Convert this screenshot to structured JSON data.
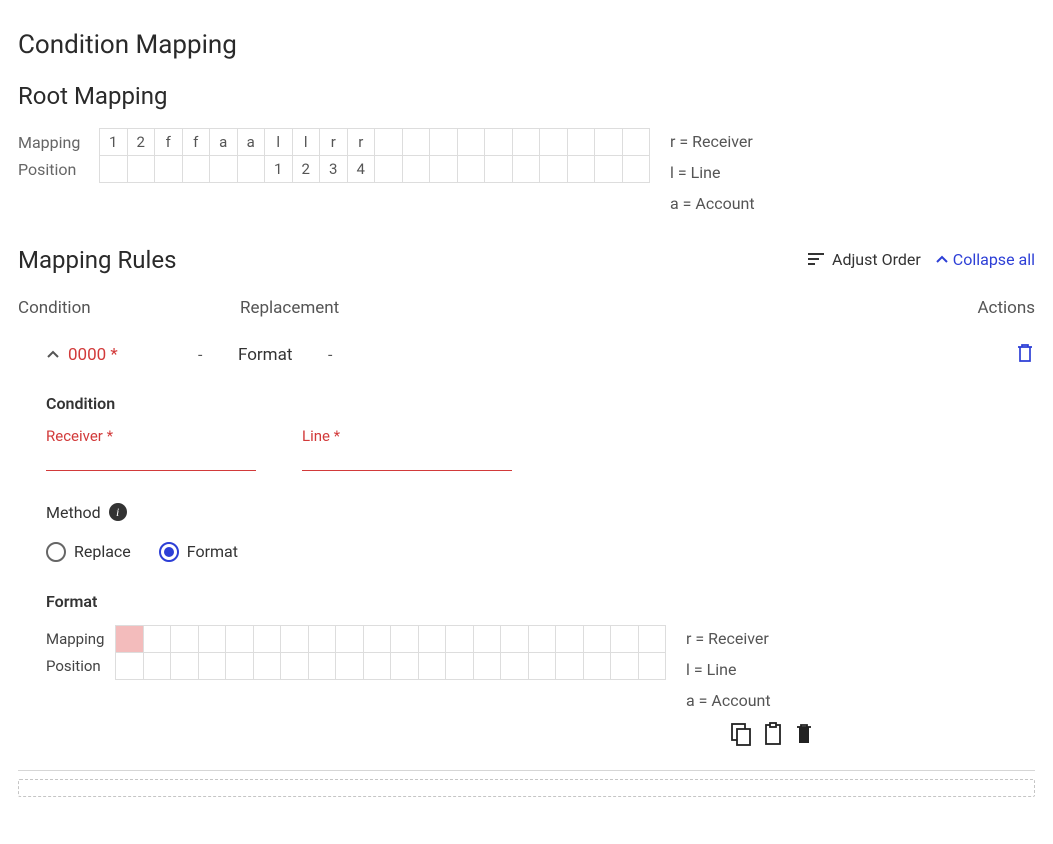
{
  "titles": {
    "condition_mapping": "Condition Mapping",
    "root_mapping": "Root Mapping",
    "mapping_rules": "Mapping Rules"
  },
  "root_mapping": {
    "row_labels": {
      "mapping": "Mapping",
      "position": "Position"
    },
    "cell_count": 20,
    "mapping_cells": [
      "1",
      "2",
      "f",
      "f",
      "a",
      "a",
      "l",
      "l",
      "r",
      "r",
      "",
      "",
      "",
      "",
      "",
      "",
      "",
      "",
      "",
      ""
    ],
    "position_cells": [
      "",
      "",
      "",
      "",
      "",
      "",
      "1",
      "2",
      "3",
      "4",
      "",
      "",
      "",
      "",
      "",
      "",
      "",
      "",
      "",
      ""
    ]
  },
  "legend": [
    {
      "k": "r",
      "v": "Receiver"
    },
    {
      "k": "l",
      "v": "Line"
    },
    {
      "k": "a",
      "v": "Account"
    }
  ],
  "mapping_rules": {
    "actions": {
      "adjust_order": "Adjust Order",
      "collapse_all": "Collapse all"
    },
    "headers": {
      "condition": "Condition",
      "replacement": "Replacement",
      "actions": "Actions"
    }
  },
  "rule": {
    "condition_display": "0000 *",
    "sep": "-",
    "replacement_display": "Format",
    "sep2": "-",
    "detail": {
      "condition_title": "Condition",
      "receiver_label": "Receiver *",
      "line_label": "Line *",
      "receiver_value": "",
      "line_value": "",
      "method_label": "Method",
      "radios": {
        "replace": "Replace",
        "format": "Format",
        "selected": "format"
      },
      "format_title": "Format",
      "format": {
        "row_labels": {
          "mapping": "Mapping",
          "position": "Position"
        },
        "cell_count": 20,
        "mapping_cells": [
          "",
          "",
          "",
          "",
          "",
          "",
          "",
          "",
          "",
          "",
          "",
          "",
          "",
          "",
          "",
          "",
          "",
          "",
          "",
          ""
        ],
        "position_cells": [
          "",
          "",
          "",
          "",
          "",
          "",
          "",
          "",
          "",
          "",
          "",
          "",
          "",
          "",
          "",
          "",
          "",
          "",
          "",
          ""
        ],
        "highlight_index": 0
      }
    }
  }
}
